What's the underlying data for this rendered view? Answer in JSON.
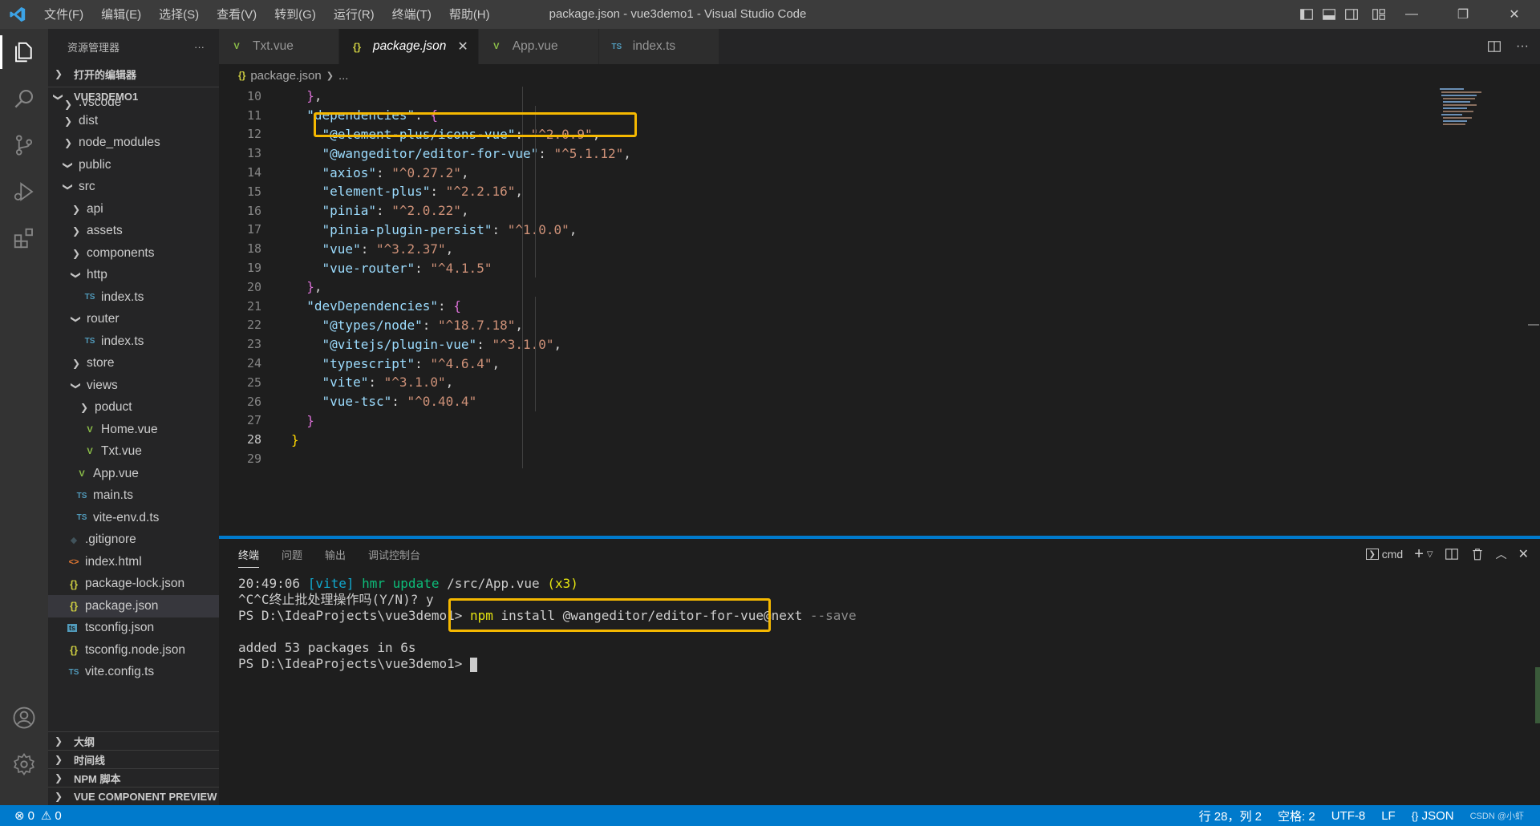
{
  "window": {
    "title": "package.json - vue3demo1 - Visual Studio Code",
    "menu": [
      "文件(F)",
      "编辑(E)",
      "选择(S)",
      "查看(V)",
      "转到(G)",
      "运行(R)",
      "终端(T)",
      "帮助(H)"
    ]
  },
  "sidebar": {
    "header": "资源管理器",
    "more": "···",
    "open_editors": "打开的编辑器",
    "project": "VUE3DEMO1",
    "tree": [
      {
        "label": ".vscode",
        "type": "folder",
        "depth": 1,
        "open": false,
        "partial": true
      },
      {
        "label": "dist",
        "type": "folder",
        "depth": 1,
        "open": false
      },
      {
        "label": "node_modules",
        "type": "folder",
        "depth": 1,
        "open": false
      },
      {
        "label": "public",
        "type": "folder",
        "depth": 1,
        "open": true
      },
      {
        "label": "src",
        "type": "folder",
        "depth": 1,
        "open": true
      },
      {
        "label": "api",
        "type": "folder",
        "depth": 2,
        "open": false
      },
      {
        "label": "assets",
        "type": "folder",
        "depth": 2,
        "open": false
      },
      {
        "label": "components",
        "type": "folder",
        "depth": 2,
        "open": false
      },
      {
        "label": "http",
        "type": "folder",
        "depth": 2,
        "open": true
      },
      {
        "label": "index.ts",
        "type": "ts",
        "depth": 3
      },
      {
        "label": "router",
        "type": "folder",
        "depth": 2,
        "open": true
      },
      {
        "label": "index.ts",
        "type": "ts",
        "depth": 3
      },
      {
        "label": "store",
        "type": "folder",
        "depth": 2,
        "open": false
      },
      {
        "label": "views",
        "type": "folder",
        "depth": 2,
        "open": true
      },
      {
        "label": "poduct",
        "type": "folder",
        "depth": 3,
        "open": false
      },
      {
        "label": "Home.vue",
        "type": "vue",
        "depth": 3
      },
      {
        "label": "Txt.vue",
        "type": "vue",
        "depth": 3
      },
      {
        "label": "App.vue",
        "type": "vue",
        "depth": 2
      },
      {
        "label": "main.ts",
        "type": "ts",
        "depth": 2
      },
      {
        "label": "vite-env.d.ts",
        "type": "ts",
        "depth": 2
      },
      {
        "label": ".gitignore",
        "type": "git",
        "depth": 1
      },
      {
        "label": "index.html",
        "type": "html",
        "depth": 1
      },
      {
        "label": "package-lock.json",
        "type": "json",
        "depth": 1
      },
      {
        "label": "package.json",
        "type": "json",
        "depth": 1,
        "selected": true
      },
      {
        "label": "tsconfig.json",
        "type": "tsconfig",
        "depth": 1
      },
      {
        "label": "tsconfig.node.json",
        "type": "json",
        "depth": 1
      },
      {
        "label": "vite.config.ts",
        "type": "ts",
        "depth": 1
      }
    ],
    "bottom_sections": [
      "大纲",
      "时间线",
      "NPM 脚本",
      "VUE COMPONENT PREVIEW"
    ]
  },
  "tabs": [
    {
      "label": "Txt.vue",
      "icon": "vue",
      "active": false
    },
    {
      "label": "package.json",
      "icon": "json",
      "active": true
    },
    {
      "label": "App.vue",
      "icon": "vue",
      "active": false
    },
    {
      "label": "index.ts",
      "icon": "ts",
      "active": false
    }
  ],
  "breadcrumb": {
    "file": "package.json",
    "rest": "..."
  },
  "code_lines": [
    {
      "n": "10",
      "html": "  <span class=\"b1\">}</span><span class=\"p\">,</span>"
    },
    {
      "n": "11",
      "html": "  <span class=\"k\">\"dependencies\"</span><span class=\"p\">: </span><span class=\"b1\">{</span>"
    },
    {
      "n": "12",
      "html": "    <span class=\"k\">\"@element-plus/icons-vue\"</span><span class=\"p\">: </span><span class=\"s\">\"^2.0.9\"</span><span class=\"p\">,</span>"
    },
    {
      "n": "13",
      "html": "    <span class=\"k\">\"@wangeditor/editor-for-vue\"</span><span class=\"p\">: </span><span class=\"s\">\"^5.1.12\"</span><span class=\"p\">,</span>"
    },
    {
      "n": "14",
      "html": "    <span class=\"k\">\"axios\"</span><span class=\"p\">: </span><span class=\"s\">\"^0.27.2\"</span><span class=\"p\">,</span>"
    },
    {
      "n": "15",
      "html": "    <span class=\"k\">\"element-plus\"</span><span class=\"p\">: </span><span class=\"s\">\"^2.2.16\"</span><span class=\"p\">,</span>"
    },
    {
      "n": "16",
      "html": "    <span class=\"k\">\"pinia\"</span><span class=\"p\">: </span><span class=\"s\">\"^2.0.22\"</span><span class=\"p\">,</span>"
    },
    {
      "n": "17",
      "html": "    <span class=\"k\">\"pinia-plugin-persist\"</span><span class=\"p\">: </span><span class=\"s\">\"^1.0.0\"</span><span class=\"p\">,</span>"
    },
    {
      "n": "18",
      "html": "    <span class=\"k\">\"vue\"</span><span class=\"p\">: </span><span class=\"s\">\"^3.2.37\"</span><span class=\"p\">,</span>"
    },
    {
      "n": "19",
      "html": "    <span class=\"k\">\"vue-router\"</span><span class=\"p\">: </span><span class=\"s\">\"^4.1.5\"</span>"
    },
    {
      "n": "20",
      "html": "  <span class=\"b1\">}</span><span class=\"p\">,</span>"
    },
    {
      "n": "21",
      "html": "  <span class=\"k\">\"devDependencies\"</span><span class=\"p\">: </span><span class=\"b1\">{</span>"
    },
    {
      "n": "22",
      "html": "    <span class=\"k\">\"@types/node\"</span><span class=\"p\">: </span><span class=\"s\">\"^18.7.18\"</span><span class=\"p\">,</span>"
    },
    {
      "n": "23",
      "html": "    <span class=\"k\">\"@vitejs/plugin-vue\"</span><span class=\"p\">: </span><span class=\"s\">\"^3.1.0\"</span><span class=\"p\">,</span>"
    },
    {
      "n": "24",
      "html": "    <span class=\"k\">\"typescript\"</span><span class=\"p\">: </span><span class=\"s\">\"^4.6.4\"</span><span class=\"p\">,</span>"
    },
    {
      "n": "25",
      "html": "    <span class=\"k\">\"vite\"</span><span class=\"p\">: </span><span class=\"s\">\"^3.1.0\"</span><span class=\"p\">,</span>"
    },
    {
      "n": "26",
      "html": "    <span class=\"k\">\"vue-tsc\"</span><span class=\"p\">: </span><span class=\"s\">\"^0.40.4\"</span>"
    },
    {
      "n": "27",
      "html": "  <span class=\"b1\">}</span>"
    },
    {
      "n": "28",
      "html": "<span class=\"b0\">}</span>",
      "current": true
    },
    {
      "n": "29",
      "html": ""
    }
  ],
  "panel": {
    "tabs": [
      "终端",
      "问题",
      "输出",
      "调试控制台"
    ],
    "shell": "cmd"
  },
  "terminal": {
    "line1_time": "20:49:06 ",
    "line1_vite": "[vite]",
    "line1_hmr": " hmr update ",
    "line1_file": "/src/App.vue",
    "line1_count": " (x3)",
    "line2": "^C^C终止批处理操作吗(Y/N)? y",
    "line3_prompt": "PS D:\\IdeaProjects\\vue3demo1> ",
    "line3_npm": "npm",
    "line3_cmd": " install @wangeditor/editor-for-vue@next ",
    "line3_flag": "--save",
    "line4": "",
    "line5": "added 53 packages in 6s",
    "line6_prompt": "PS D:\\IdeaProjects\\vue3demo1> "
  },
  "status": {
    "errors": "0",
    "warnings": "0",
    "position": "行 28，列 2",
    "spaces": "空格: 2",
    "encoding": "UTF-8",
    "eol": "LF",
    "language": "JSON",
    "watermark": "CSDN @小虾"
  },
  "colors": {
    "accent": "#007acc",
    "highlight_box": "#f5b800"
  }
}
